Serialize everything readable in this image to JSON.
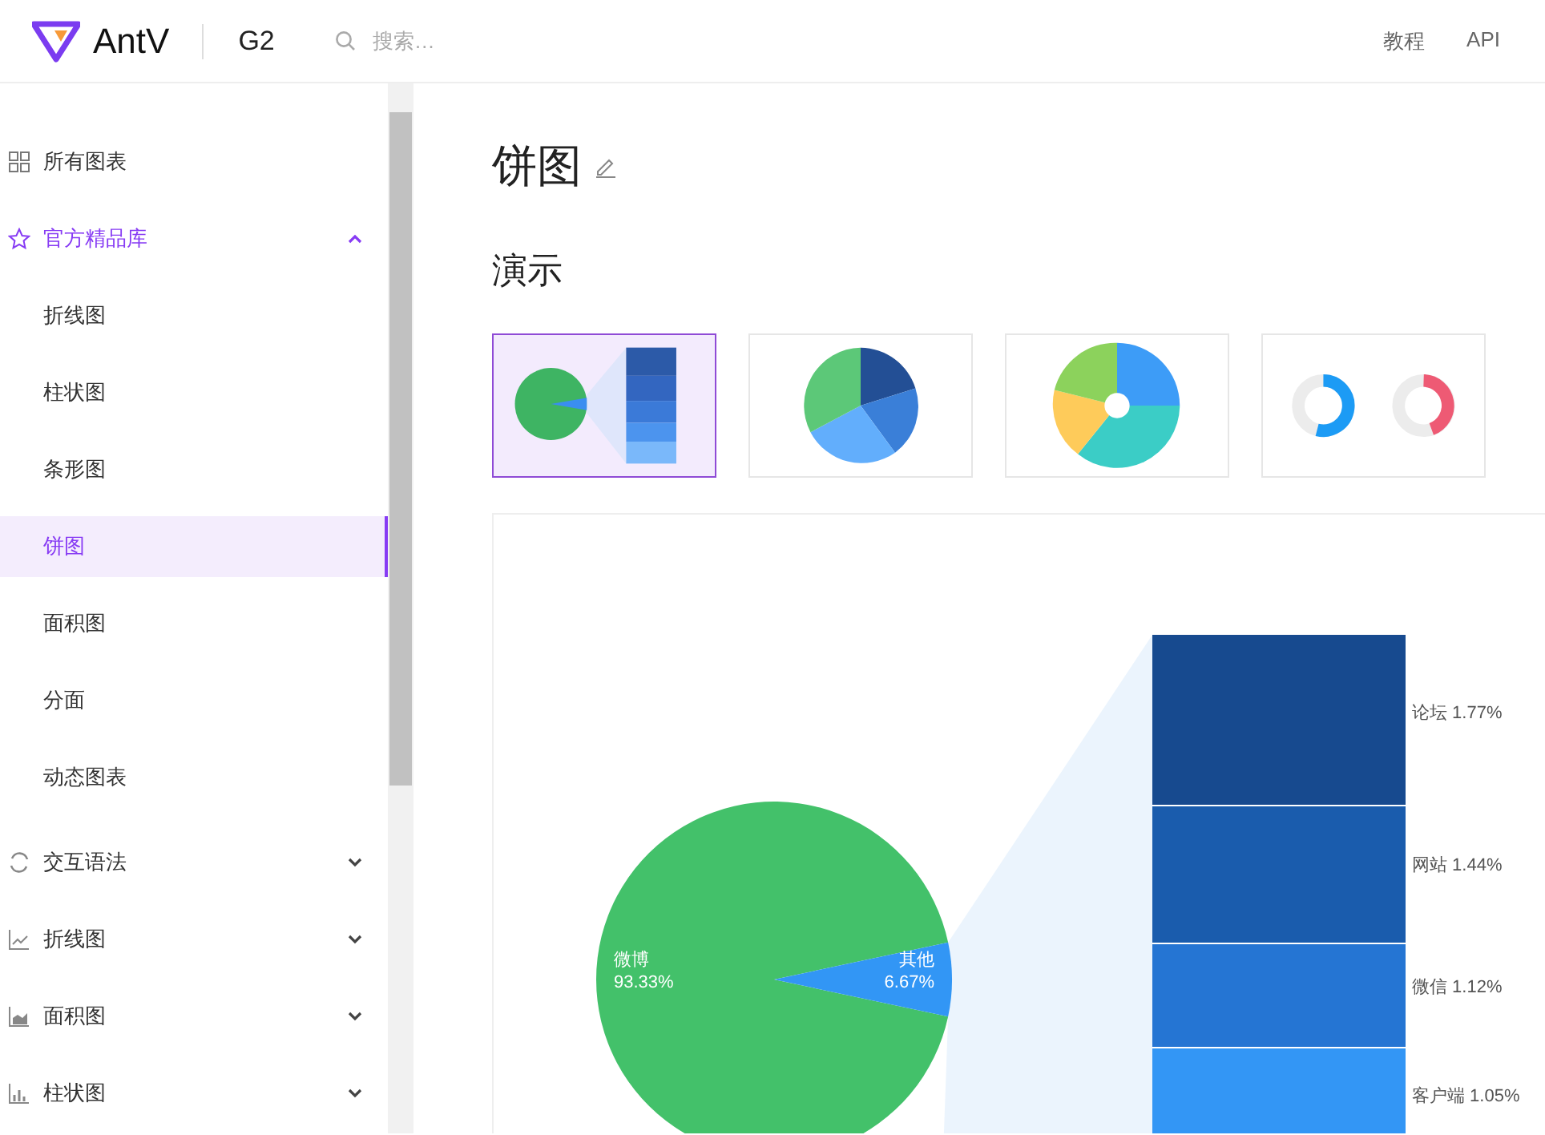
{
  "header": {
    "logo": "AntV",
    "product": "G2",
    "search": {
      "placeholder": "搜索…"
    },
    "nav": [
      {
        "label": "教程",
        "selected": false
      },
      {
        "label": "API",
        "selected": false
      }
    ]
  },
  "sidebar": {
    "items": [
      {
        "kind": "link",
        "label": "所有图表",
        "selected": false
      },
      {
        "kind": "group",
        "label": "官方精品库",
        "expanded": true,
        "selected": true,
        "children": [
          {
            "label": "折线图",
            "selected": false
          },
          {
            "label": "柱状图",
            "selected": false
          },
          {
            "label": "条形图",
            "selected": false
          },
          {
            "label": "饼图",
            "selected": true
          },
          {
            "label": "面积图",
            "selected": false
          },
          {
            "label": "分面",
            "selected": false
          },
          {
            "label": "动态图表",
            "selected": false
          }
        ]
      },
      {
        "kind": "group",
        "label": "交互语法",
        "expanded": false,
        "selected": false
      },
      {
        "kind": "group",
        "label": "折线图",
        "expanded": false,
        "selected": false
      },
      {
        "kind": "group",
        "label": "面积图",
        "expanded": false,
        "selected": false
      },
      {
        "kind": "group",
        "label": "柱状图",
        "expanded": false,
        "selected": false
      }
    ]
  },
  "main": {
    "title": "饼图",
    "section": "演示",
    "demos": [
      {
        "kind": "pie-of-bar",
        "selected": true
      },
      {
        "kind": "pie",
        "selected": false
      },
      {
        "kind": "sunburst",
        "selected": false
      },
      {
        "kind": "rings",
        "selected": false
      }
    ],
    "chart": {
      "pie_labels": [
        {
          "name": "微博",
          "value": "93.33%"
        },
        {
          "name": "其他",
          "value": "6.67%"
        }
      ],
      "bar_labels": [
        "论坛 1.77%",
        "网站 1.44%",
        "微信 1.12%",
        "客户端 1.05%"
      ]
    }
  }
}
